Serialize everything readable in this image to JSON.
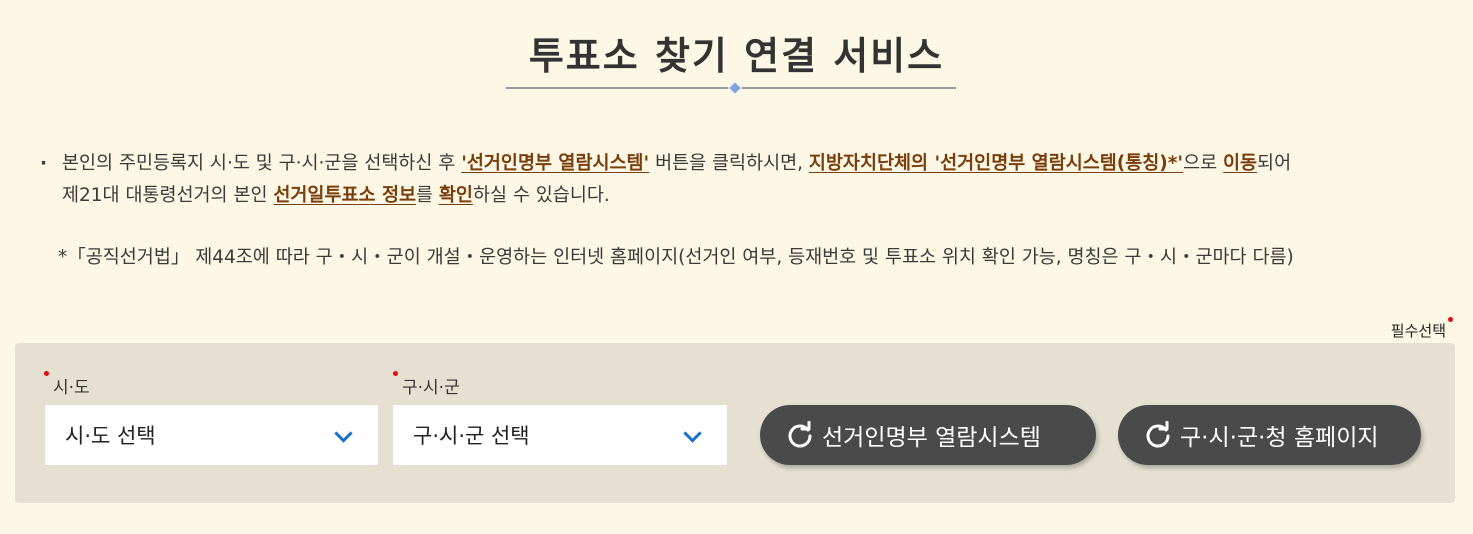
{
  "title": "투표소 찾기 연결 서비스",
  "description": {
    "bullet": "·",
    "line1": [
      {
        "text": "본인의 주민등록지 시·도 및 구·시·군을 선택하신 후 ",
        "hl": false
      },
      {
        "text": "'선거인명부 열람시스템'",
        "hl": true
      },
      {
        "text": " 버튼을 클릭하시면, ",
        "hl": false
      },
      {
        "text": "지방자치단체의 '선거인명부 열람시스템(통칭)*'",
        "hl": true
      },
      {
        "text": "으로 ",
        "hl": false
      },
      {
        "text": "이동",
        "hl": true
      },
      {
        "text": "되어",
        "hl": false
      }
    ],
    "line2": [
      {
        "text": "제21대 대통령선거의 본인 ",
        "hl": false
      },
      {
        "text": "선거일투표소 정보",
        "hl": true
      },
      {
        "text": "를 ",
        "hl": false
      },
      {
        "text": "확인",
        "hl": true
      },
      {
        "text": "하실 수 있습니다.",
        "hl": false
      }
    ],
    "note": "*「공직선거법」 제44조에 따라 구・시・군이 개설・운영하는 인터넷 홈페이지(선거인 여부, 등재번호 및 투표소 위치 확인 가능, 명칭은 구・시・군마다 다름)"
  },
  "required_label": "필수선택",
  "form": {
    "sido_label": "시·도",
    "sido_value": "시·도 선택",
    "sigungu_label": "구·시·군",
    "sigungu_value": "구·시·군 선택"
  },
  "buttons": {
    "registry_label": "선거인명부 열람시스템",
    "homepage_label": "구·시·군·청 홈페이지",
    "icon": "refresh-icon"
  },
  "colors": {
    "background": "#fdf8e6",
    "panel": "#e5e0d2",
    "highlight": "#7a3e0c",
    "button": "#4a4a4a",
    "chevron": "#1a73c9",
    "required_dot": "#e01010"
  }
}
